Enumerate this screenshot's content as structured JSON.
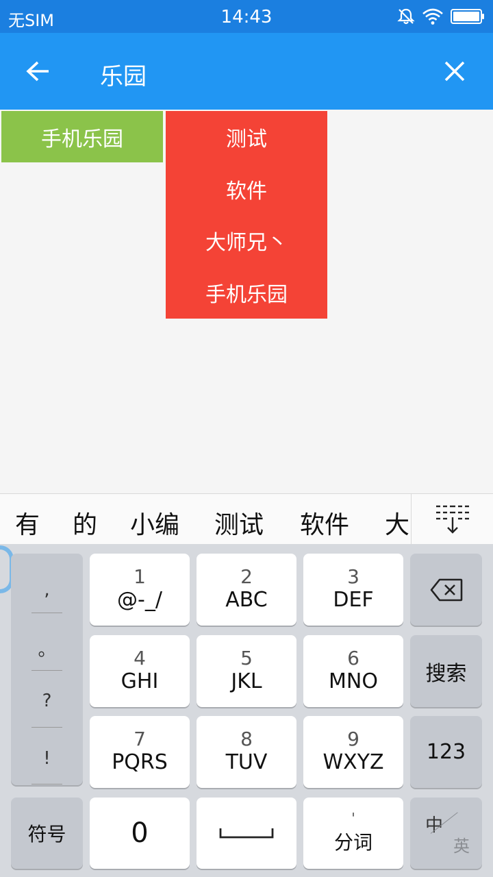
{
  "status_bar": {
    "carrier": "无SIM",
    "time": "14:43"
  },
  "app_bar": {
    "search_text": "乐园"
  },
  "results": {
    "green_tag": "手机乐园",
    "red_list": [
      "测试",
      "软件",
      "大师兄丶",
      "手机乐园"
    ]
  },
  "candidates": [
    "有",
    "的",
    "小编",
    "测试",
    "软件",
    "大"
  ],
  "keyboard": {
    "punctuation": [
      ",",
      "。",
      "?",
      "!"
    ],
    "keys": [
      {
        "num": "1",
        "letters": "@-_/"
      },
      {
        "num": "2",
        "letters": "ABC"
      },
      {
        "num": "3",
        "letters": "DEF"
      },
      {
        "num": "4",
        "letters": "GHI"
      },
      {
        "num": "5",
        "letters": "JKL"
      },
      {
        "num": "6",
        "letters": "MNO"
      },
      {
        "num": "7",
        "letters": "PQRS"
      },
      {
        "num": "8",
        "letters": "TUV"
      },
      {
        "num": "9",
        "letters": "WXYZ"
      }
    ],
    "search_label": "搜索",
    "numeric_label": "123",
    "symbols_label": "符号",
    "zero_label": "0",
    "split_word_mark": "'",
    "split_word_label": "分词",
    "lang_zh": "中",
    "lang_en": "英"
  },
  "colors": {
    "statusbar": "#1b7fe0",
    "appbar": "#2196f3",
    "green_tag": "#8bc34a",
    "red_list": "#f44336"
  }
}
